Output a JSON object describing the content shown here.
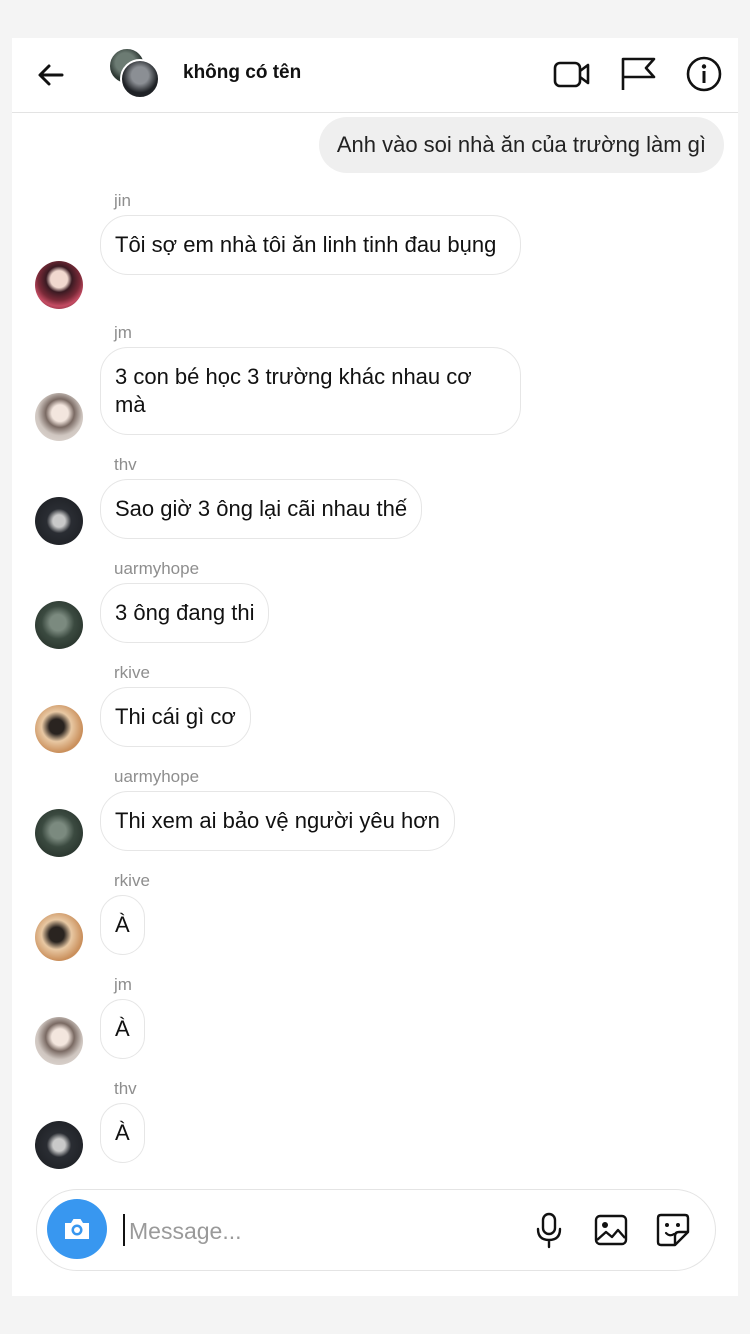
{
  "header": {
    "title": "không có tên",
    "icons": [
      "back-arrow-icon",
      "group-avatar",
      "video-camera-icon",
      "flag-icon",
      "info-icon"
    ]
  },
  "messages": [
    {
      "type": "sent",
      "text": "Anh vào soi nhà ăn của trường làm gì"
    },
    {
      "type": "received",
      "sender": "jin",
      "text": "Tôi sợ em nhà tôi ăn linh tinh đau bụng"
    },
    {
      "type": "received",
      "sender": "jm",
      "text": "3 con bé học 3 trường khác nhau cơ mà"
    },
    {
      "type": "received",
      "sender": "thv",
      "text": "Sao giờ 3 ông lại cãi nhau thế"
    },
    {
      "type": "received",
      "sender": "uarmyhope",
      "text": "3 ông đang thi"
    },
    {
      "type": "received",
      "sender": "rkive",
      "text": "Thi cái gì cơ"
    },
    {
      "type": "received",
      "sender": "uarmyhope",
      "text": "Thi xem ai bảo vệ người yêu hơn"
    },
    {
      "type": "received",
      "sender": "rkive",
      "text": "À"
    },
    {
      "type": "received",
      "sender": "jm",
      "text": "À"
    },
    {
      "type": "received",
      "sender": "thv",
      "text": "À"
    }
  ],
  "composer": {
    "placeholder": "Message...",
    "value": "",
    "icons": [
      "camera-icon",
      "microphone-icon",
      "gallery-icon",
      "sticker-icon"
    ]
  },
  "colors": {
    "accent": "#3897f0",
    "sent_bubble": "#efefef",
    "name_gray": "#8e8e8e"
  }
}
